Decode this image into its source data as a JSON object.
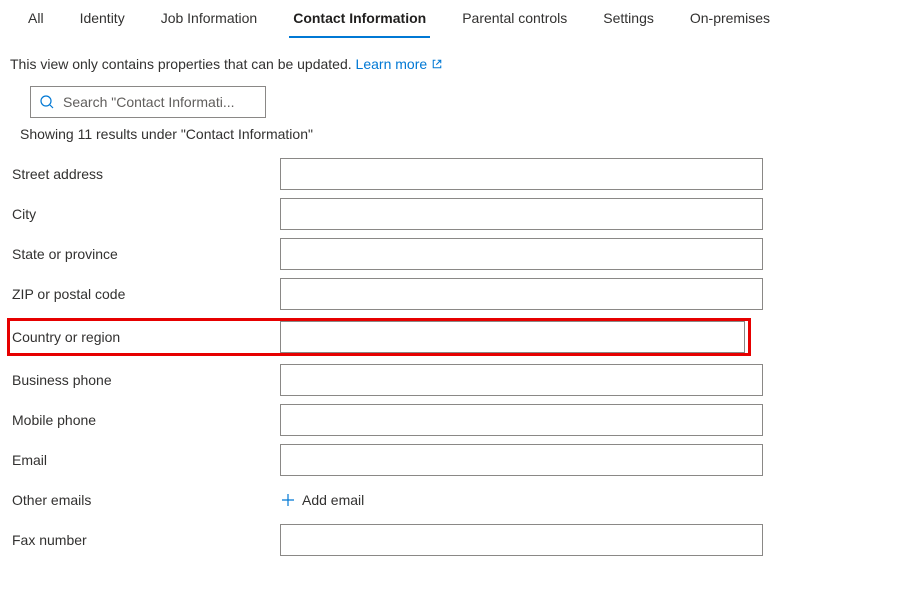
{
  "tabs": [
    {
      "key": "all",
      "label": "All"
    },
    {
      "key": "identity",
      "label": "Identity"
    },
    {
      "key": "job",
      "label": "Job Information"
    },
    {
      "key": "contact",
      "label": "Contact Information",
      "active": true
    },
    {
      "key": "parental",
      "label": "Parental controls"
    },
    {
      "key": "settings",
      "label": "Settings"
    },
    {
      "key": "onprem",
      "label": "On-premises"
    }
  ],
  "info_text": "This view only contains properties that can be updated.",
  "learn_more": "Learn more",
  "search": {
    "placeholder": "Search \"Contact Informati..."
  },
  "results_text": "Showing 11 results under \"Contact Information\"",
  "fields": [
    {
      "key": "street",
      "label": "Street address",
      "value": "",
      "type": "text"
    },
    {
      "key": "city",
      "label": "City",
      "value": "",
      "type": "text"
    },
    {
      "key": "state",
      "label": "State or province",
      "value": "",
      "type": "text"
    },
    {
      "key": "zip",
      "label": "ZIP or postal code",
      "value": "",
      "type": "text"
    },
    {
      "key": "country",
      "label": "Country or region",
      "value": "",
      "type": "text",
      "highlight": true
    },
    {
      "key": "bphone",
      "label": "Business phone",
      "value": "",
      "type": "text"
    },
    {
      "key": "mphone",
      "label": "Mobile phone",
      "value": "",
      "type": "text"
    },
    {
      "key": "email",
      "label": "Email",
      "value": "",
      "type": "text"
    },
    {
      "key": "otheremails",
      "label": "Other emails",
      "type": "addemail"
    },
    {
      "key": "fax",
      "label": "Fax number",
      "value": "",
      "type": "text"
    }
  ],
  "add_email_label": "Add email"
}
